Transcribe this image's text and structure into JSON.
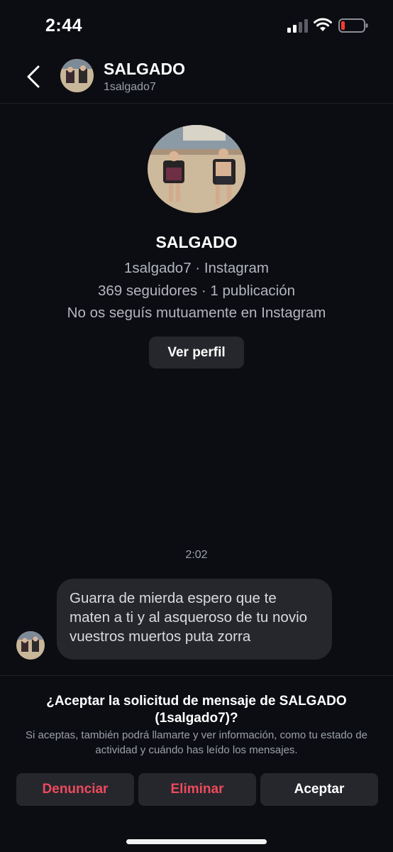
{
  "status_bar": {
    "time": "2:44"
  },
  "header": {
    "name": "SALGADO",
    "username": "1salgado7"
  },
  "profile": {
    "name": "SALGADO",
    "line1": "1salgado7 · Instagram",
    "line2": "369 seguidores · 1 publicación",
    "line3": "No os seguís mutuamente en Instagram",
    "view_profile_label": "Ver perfil"
  },
  "chat": {
    "timestamp": "2:02",
    "message": "Guarra de mierda espero que te maten a ti y al asqueroso de tu novio vuestros muertos puta zorra"
  },
  "request": {
    "title": "¿Aceptar la solicitud de mensaje de SALGADO (1salgado7)?",
    "description": "Si aceptas, también podrá llamarte y ver información, como tu estado de actividad y cuándo has leído los mensajes.",
    "report_label": "Denunciar",
    "delete_label": "Eliminar",
    "accept_label": "Aceptar"
  },
  "colors": {
    "background": "#0c0d12",
    "surface": "#26272d",
    "danger": "#ed4a5c",
    "muted": "#9aa0aa"
  },
  "icons": [
    "back-chevron-icon",
    "signal-icon",
    "wifi-icon",
    "battery-low-icon"
  ]
}
